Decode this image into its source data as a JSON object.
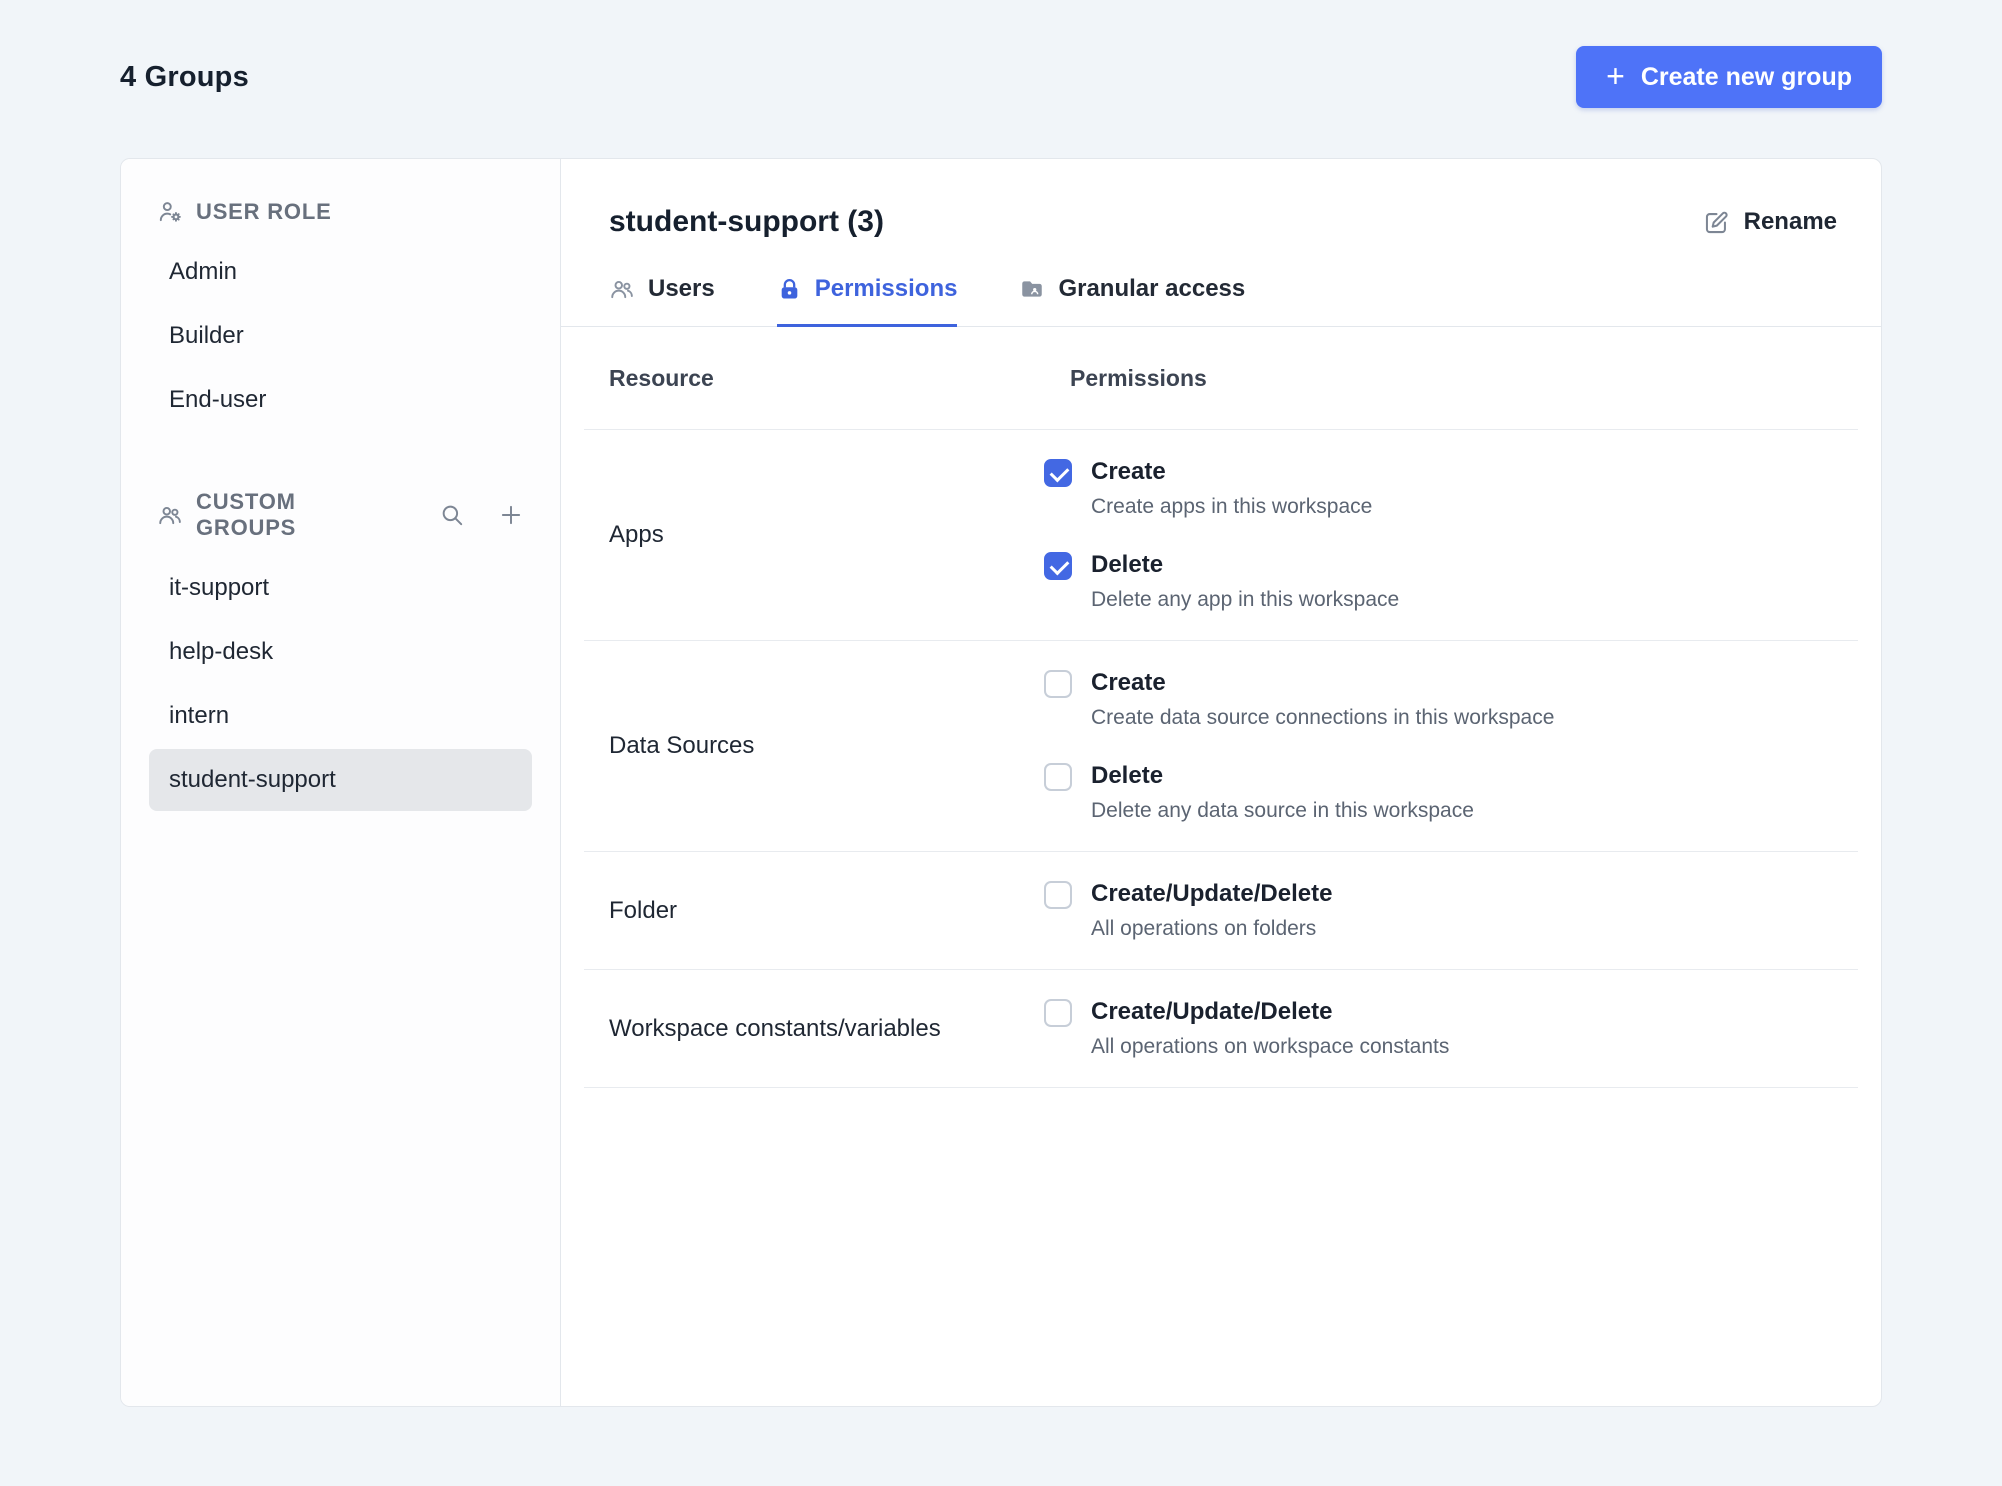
{
  "page": {
    "title": "4 Groups",
    "create_button": "Create new group"
  },
  "icons": {
    "plus": "+"
  },
  "colors": {
    "accent": "#4e73f8",
    "checkbox": "#4368e3",
    "tab_active": "#3e63dd"
  },
  "sidebar": {
    "user_role": {
      "header": "USER ROLE",
      "items": [
        "Admin",
        "Builder",
        "End-user"
      ]
    },
    "custom_groups": {
      "header": "CUSTOM GROUPS",
      "items": [
        "it-support",
        "help-desk",
        "intern",
        "student-support"
      ],
      "selected": "student-support"
    }
  },
  "main": {
    "title": "student-support (3)",
    "rename_label": "Rename",
    "tabs": [
      {
        "label": "Users",
        "active": false
      },
      {
        "label": "Permissions",
        "active": true
      },
      {
        "label": "Granular access",
        "active": false
      }
    ],
    "table": {
      "headers": {
        "resource": "Resource",
        "permissions": "Permissions"
      },
      "rows": [
        {
          "resource": "Apps",
          "permissions": [
            {
              "label": "Create",
              "description": "Create apps in this workspace",
              "checked": true
            },
            {
              "label": "Delete",
              "description": "Delete any app in this workspace",
              "checked": true
            }
          ]
        },
        {
          "resource": "Data Sources",
          "permissions": [
            {
              "label": "Create",
              "description": "Create data source connections in this workspace",
              "checked": false
            },
            {
              "label": "Delete",
              "description": "Delete any data source in this workspace",
              "checked": false
            }
          ]
        },
        {
          "resource": "Folder",
          "permissions": [
            {
              "label": "Create/Update/Delete",
              "description": "All operations on folders",
              "checked": false
            }
          ]
        },
        {
          "resource": "Workspace constants/variables",
          "permissions": [
            {
              "label": "Create/Update/Delete",
              "description": "All operations on workspace constants",
              "checked": false
            }
          ]
        }
      ]
    }
  }
}
